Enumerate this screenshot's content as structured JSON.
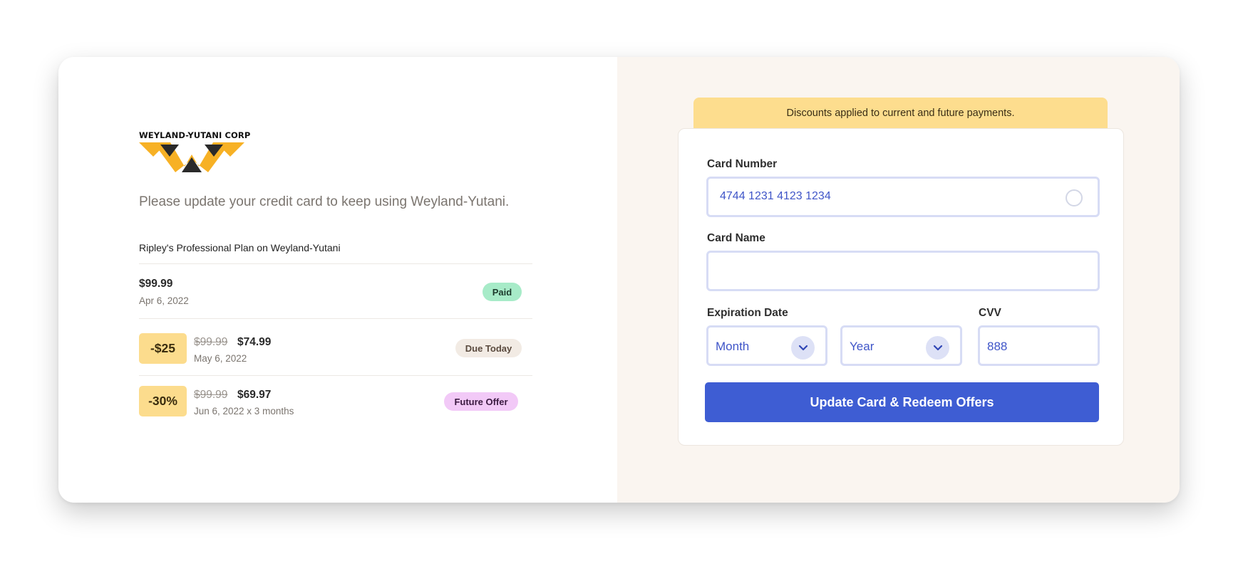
{
  "brand": {
    "logo_text": "WEYLAND-YUTANI CORP",
    "logo_colors": {
      "yellow": "#f7b125",
      "dark": "#2a2a2a"
    }
  },
  "tagline": "Please update your credit card to keep using Weyland-Yutani.",
  "plan": {
    "title": "Ripley's Professional Plan on Weyland-Yutani",
    "payments": [
      {
        "price": "$99.99",
        "date": "Apr 6, 2022",
        "status": "Paid"
      },
      {
        "discount": "-$25",
        "original_price": "$99.99",
        "price": "$74.99",
        "date": "May 6, 2022",
        "status": "Due Today"
      },
      {
        "discount": "-30%",
        "original_price": "$99.99",
        "price": "$69.97",
        "date": "Jun 6, 2022 x 3 months",
        "status": "Future Offer"
      }
    ]
  },
  "form": {
    "banner": "Discounts applied to current and future payments.",
    "card_number": {
      "label": "Card Number",
      "value": "4744 1231 4123 1234"
    },
    "card_name": {
      "label": "Card Name",
      "value": ""
    },
    "expiration": {
      "label": "Expiration Date",
      "month": {
        "selected": "Month"
      },
      "year": {
        "selected": "Year"
      }
    },
    "cvv": {
      "label": "CVV",
      "value": "888"
    },
    "submit_label": "Update Card & Redeem Offers"
  },
  "colors": {
    "accent": "#3e5dd3",
    "banner": "#fddd8e",
    "discount_tag": "#fcdc8d",
    "paid_badge": "#a7ebc8",
    "due_badge": "#f2ebe4",
    "future_badge": "#f2c9f7",
    "right_panel_bg": "#faf5f0"
  },
  "icons": {
    "chevron": "chevron-down-icon",
    "card_radio": "radio-circle-icon"
  }
}
